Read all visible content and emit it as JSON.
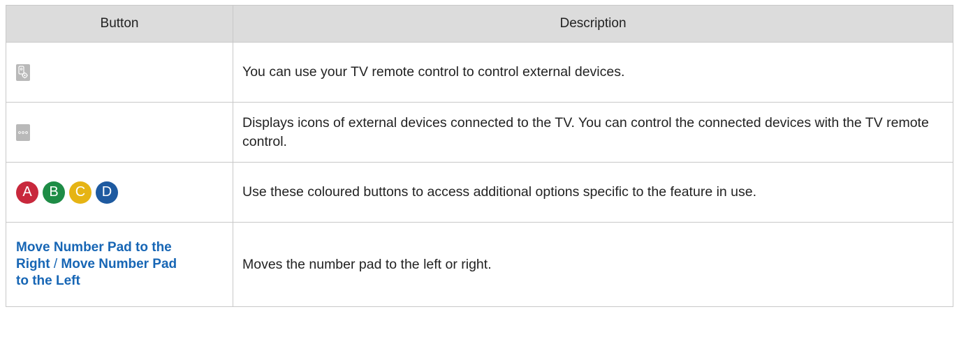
{
  "table": {
    "headers": {
      "button": "Button",
      "description": "Description"
    },
    "rows": [
      {
        "icon": "device-control-icon",
        "description": "You can use your TV remote control to control external devices."
      },
      {
        "icon": "more-dots-icon",
        "description": "Displays icons of external devices connected to the TV. You can control the connected devices with the TV remote control."
      },
      {
        "color_buttons": [
          {
            "label": "A",
            "color": "#c8283c"
          },
          {
            "label": "B",
            "color": "#1e8c46"
          },
          {
            "label": "C",
            "color": "#e6b414"
          },
          {
            "label": "D",
            "color": "#1e5aa0"
          }
        ],
        "description": "Use these coloured buttons to access additional options specific to the feature in use."
      },
      {
        "button_part1": "Move Number Pad to the Right",
        "separator": " / ",
        "button_part2": "Move Number Pad to the Left",
        "description": "Moves the number pad to the left or right."
      }
    ]
  },
  "colors": {
    "header_bg": "#dcdcdc",
    "border": "#c8c8c8",
    "link_blue": "#1766b5",
    "icon_grey": "#b9b9b9"
  }
}
